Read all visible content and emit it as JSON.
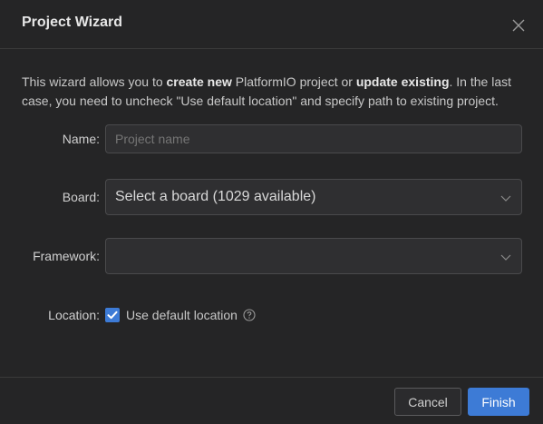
{
  "dialog": {
    "title": "Project Wizard"
  },
  "description": {
    "part1": "This wizard allows you to ",
    "bold1": "create new",
    "part2": " PlatformIO project or ",
    "bold2": "update existing",
    "part3": ". In the last case, you need to uncheck \"Use default location\" and specify path to existing project."
  },
  "form": {
    "name_label": "Name:",
    "name_placeholder": "Project name",
    "board_label": "Board:",
    "board_value": "Select a board (1029 available)",
    "framework_label": "Framework:",
    "framework_value": "",
    "location_label": "Location:",
    "use_default_location_label": "Use default location",
    "use_default_location_checked": true
  },
  "footer": {
    "cancel_label": "Cancel",
    "finish_label": "Finish"
  },
  "colors": {
    "accent": "#3d7bd6",
    "background": "#252526"
  },
  "icons": {
    "close": "close-icon",
    "chevron": "chevron-down-icon",
    "help": "help-circle-icon",
    "check": "check-icon"
  }
}
